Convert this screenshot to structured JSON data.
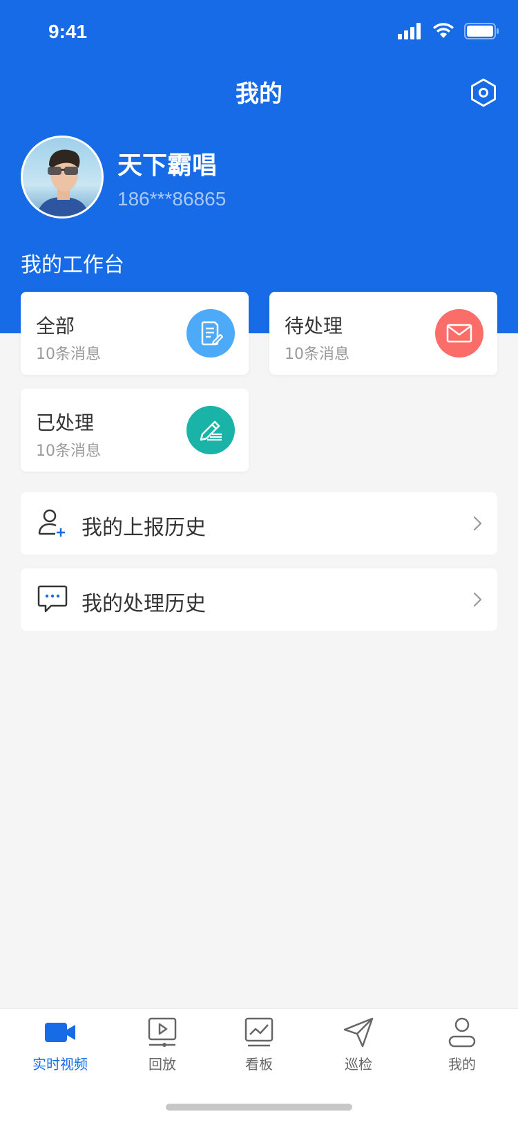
{
  "status_bar": {
    "time": "9:41"
  },
  "header": {
    "title": "我的",
    "settings_icon": "settings-hexagon-icon"
  },
  "profile": {
    "name": "天下霸唱",
    "phone": "186***86865"
  },
  "workbench": {
    "title": "我的工作台",
    "cards": [
      {
        "title": "全部",
        "subtitle": "10条消息",
        "icon": "document-edit-icon",
        "color": "#4daaf8"
      },
      {
        "title": "待处理",
        "subtitle": "10条消息",
        "icon": "mail-icon",
        "color": "#fb6d68"
      },
      {
        "title": "已处理",
        "subtitle": "10条消息",
        "icon": "pen-lines-icon",
        "color": "#1ab3a8"
      }
    ]
  },
  "menu": [
    {
      "label": "我的上报历史",
      "icon": "user-add-icon"
    },
    {
      "label": "我的处理历史",
      "icon": "chat-bubble-icon"
    }
  ],
  "tabbar": {
    "active_color": "#176be6",
    "items": [
      {
        "label": "实时视频",
        "icon": "video-camera-icon",
        "active": true
      },
      {
        "label": "回放",
        "icon": "playback-icon",
        "active": false
      },
      {
        "label": "看板",
        "icon": "dashboard-icon",
        "active": false
      },
      {
        "label": "巡检",
        "icon": "send-icon",
        "active": false
      },
      {
        "label": "我的",
        "icon": "user-icon",
        "active": false
      }
    ]
  },
  "colors": {
    "header_bg": "#176be6",
    "page_bg": "#f5f5f5"
  }
}
